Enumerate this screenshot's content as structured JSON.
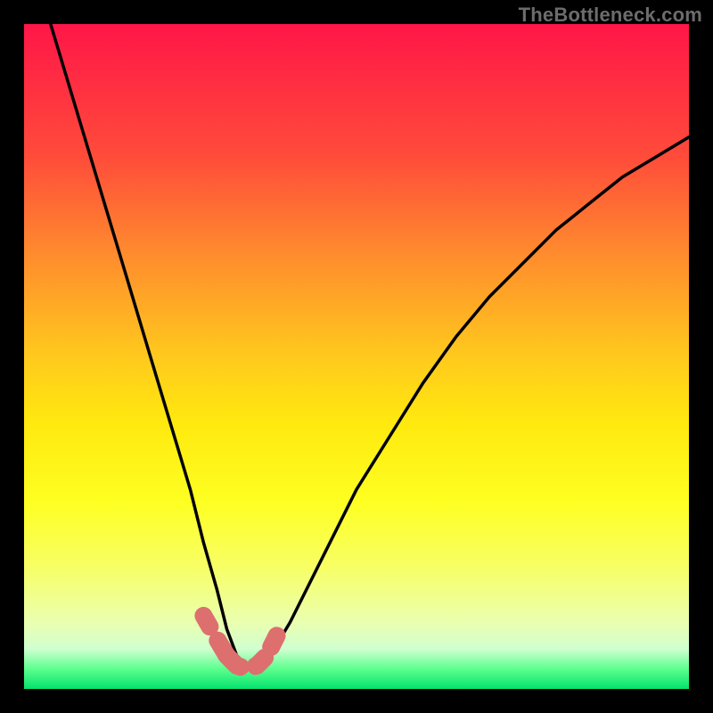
{
  "watermark": "TheBottleneck.com",
  "chart_data": {
    "type": "line",
    "title": "",
    "xlabel": "",
    "ylabel": "",
    "xlim": [
      0,
      100
    ],
    "ylim": [
      0,
      100
    ],
    "legend": false,
    "grid": false,
    "background": "rainbow-vertical",
    "series": [
      {
        "name": "bottleneck-curve",
        "color": "#000000",
        "x": [
          4,
          7,
          10,
          13,
          16,
          19,
          22,
          25,
          27,
          29,
          30.5,
          32,
          33.5,
          35,
          37,
          40,
          45,
          50,
          55,
          60,
          65,
          70,
          75,
          80,
          85,
          90,
          95,
          100
        ],
        "values": [
          100,
          90,
          80,
          70,
          60,
          50,
          40,
          30,
          22,
          15,
          9,
          5,
          3,
          3,
          5,
          10,
          20,
          30,
          38,
          46,
          53,
          59,
          64,
          69,
          73,
          77,
          80,
          83
        ]
      },
      {
        "name": "highlight-bottom",
        "color": "#de6f6f",
        "x": [
          27,
          29,
          30.5,
          32,
          33.5,
          35,
          36.5,
          38
        ],
        "values": [
          11,
          7.5,
          5,
          3.5,
          3,
          3.5,
          5,
          8
        ]
      }
    ],
    "frame": {
      "outer_color": "#000000",
      "inner_rect": [
        27,
        27,
        746,
        746
      ]
    }
  }
}
